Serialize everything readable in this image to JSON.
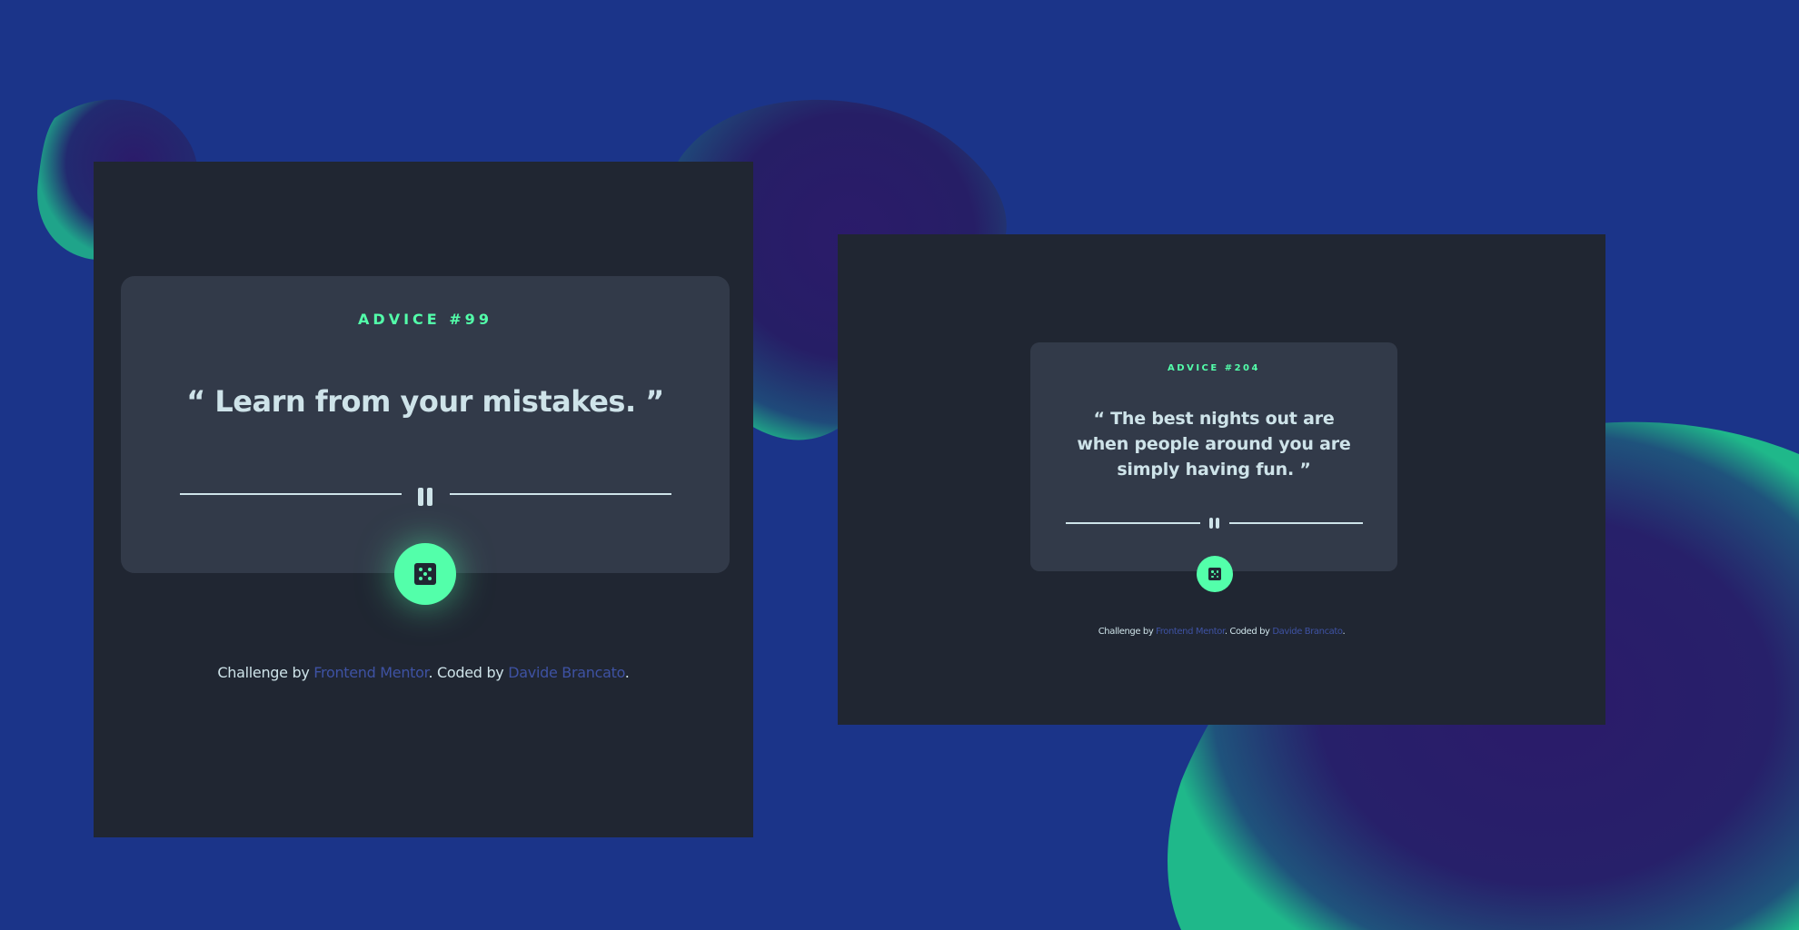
{
  "colors": {
    "background": "#1b3489",
    "screen": "#202632",
    "card": "#323a49",
    "accent_green": "#53ffaa",
    "light_cyan": "#cee3e9",
    "link_blue": "#3e52a3"
  },
  "desktop": {
    "advice_label": "ADVICE #99",
    "quote": "“ Learn from your mistakes. ”",
    "attribution": {
      "prefix": "Challenge by ",
      "link1": "Frontend Mentor",
      "middle": ". Coded by ",
      "link2": "Davide Brancato",
      "suffix": "."
    }
  },
  "mobile": {
    "advice_label": "ADVICE #204",
    "quote": "“ The best nights out are when people around you are simply having fun. ”",
    "attribution": {
      "prefix": "Challenge by ",
      "link1": "Frontend Mentor",
      "middle": ". Coded by ",
      "link2": "Davide Brancato",
      "suffix": "."
    }
  },
  "icons": {
    "divider": "pause-icon",
    "button": "dice-icon"
  }
}
